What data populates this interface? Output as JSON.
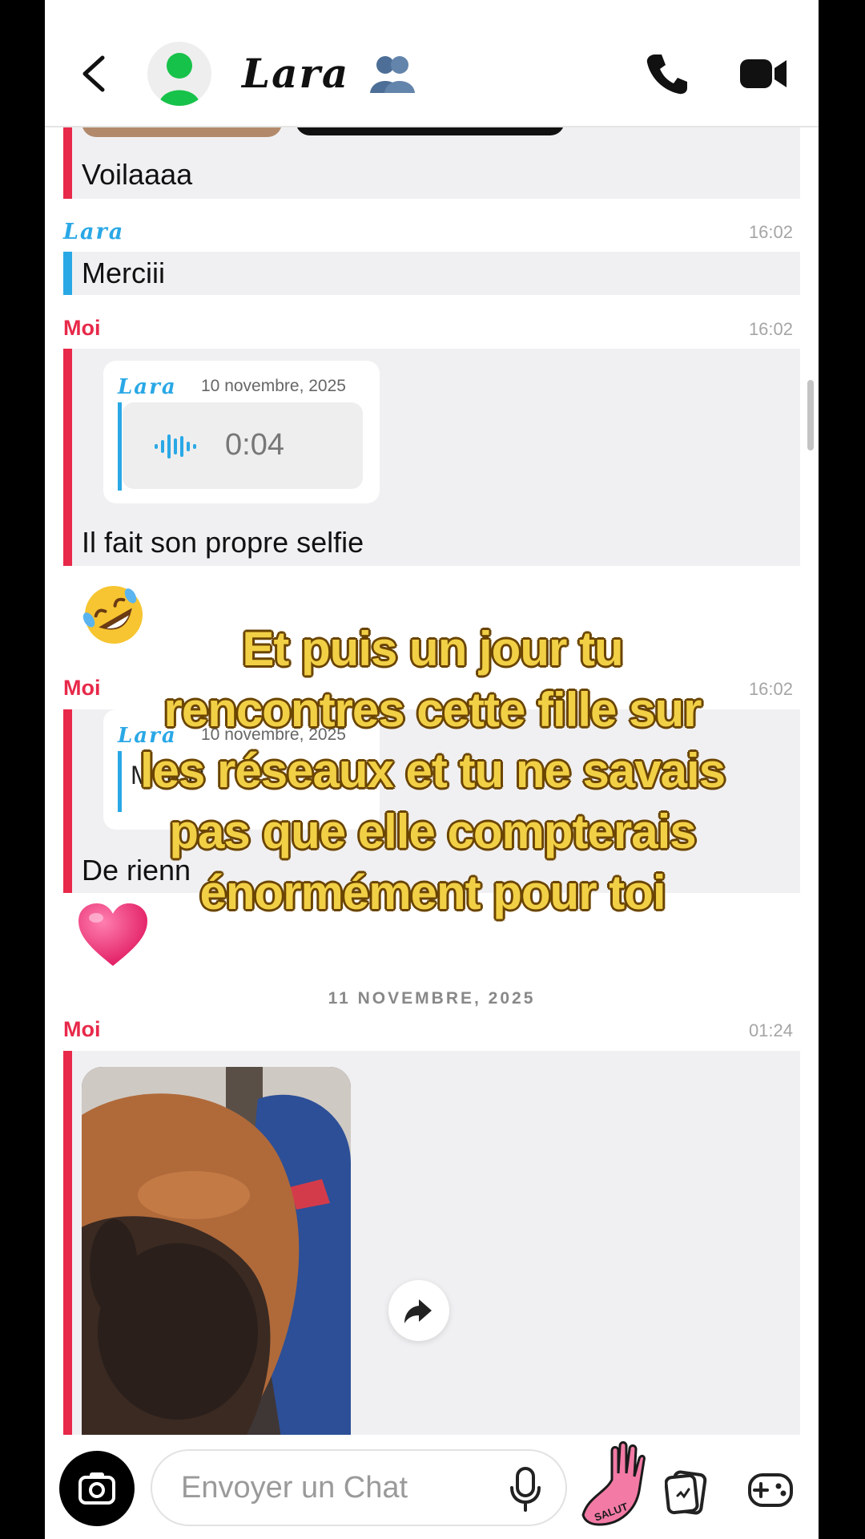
{
  "header": {
    "back_icon": "chevron-left-icon",
    "avatar_icon": "bitmoji-avatar-icon",
    "contact_name": "Lara",
    "group_icon": "friends-group-icon",
    "call_icon": "phone-icon",
    "video_icon": "video-camera-icon"
  },
  "messages": {
    "m1_text": "Voilaaaa",
    "m2_sender": "Lara",
    "m2_time": "16:02",
    "m2_text": "Merciii",
    "m3_sender": "Moi",
    "m3_time": "16:02",
    "m3_quote_name": "Lara",
    "m3_quote_date": "10 novembre, 2025",
    "m3_voice_duration": "0:04",
    "m3_text": "Il fait son propre selfie",
    "reaction_1": "rolling-on-floor-laughing-emoji",
    "m4_sender": "Moi",
    "m4_time": "16:02",
    "m4_quote_name": "Lara",
    "m4_quote_date": "10 novembre, 2025",
    "m4_quote_text": "Merciii",
    "m4_text": "De rienn",
    "reaction_2": "pink-heart-emoji",
    "date_separator": "11 NOVEMBRE, 2025",
    "m5_sender": "Moi",
    "m5_time": "01:24"
  },
  "overlay_caption": [
    "Et puis un jour tu",
    "rencontres cette fille sur",
    "les réseaux et tu ne savais",
    "pas que elle compterais",
    "énormément pour toi"
  ],
  "composer": {
    "placeholder": "Envoyer un Chat",
    "sticker_text": "SALUT"
  },
  "colors": {
    "me_accent": "#e8294a",
    "friend_accent": "#2aa8e6",
    "caption_fill": "#f2d046",
    "caption_outline": "#6a4400"
  }
}
